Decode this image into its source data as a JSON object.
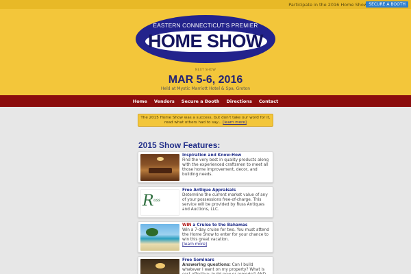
{
  "topbar": {
    "promo": "Participate in the 2016 Home Show:",
    "cta": "SECURE A BOOTH"
  },
  "header": {
    "logo_tagline": "EASTERN CONNECTICUT'S PREMIER",
    "logo_name": "HOME SHOW",
    "next_label": "NEXT SHOW",
    "dates": "MAR 5-6, 2016",
    "venue_prefix": "Held at Mystic Marriott",
    "venue_suffix": "Hotel & Spa, Groton"
  },
  "nav": {
    "items": [
      "Home",
      "Vendors",
      "Secure a Booth",
      "Directions",
      "Contact"
    ]
  },
  "notice": {
    "line1": "The 2015 Home Show was a success, but don't take our word for it,",
    "line2": "read what others had to say...",
    "link": "[learn more]"
  },
  "features": {
    "title": "2015 Show Features:",
    "cards": [
      {
        "title": "Inspiration and Know-How",
        "text": "Find the very best in quality products along with the experienced craftsmen to meet all those home improvement, decor, and building needs."
      },
      {
        "title": "Free Antique Appraisals",
        "text": "Determine the current market value of any of your possessions free-of-charge. This service will be provided by Russ Antiques and Auctions, LLC.",
        "logo_letter": "R",
        "logo_rest": "uss"
      },
      {
        "title_win": "WIN",
        "title": " a Cruise to the Bahamas",
        "text": "Win a 7-day cruise for two. You must attend the Home Show to enter for your chance to win this great vacation.",
        "link": "[learn more]"
      },
      {
        "title": "Free Seminars",
        "subtitle": "Answering questions:",
        "text": " Can I build whatever I want on my property? What is cost effective: build new or remodel? AND OTHERS"
      }
    ]
  },
  "colors": {
    "topbar": "#e8b927",
    "header": "#f3c63a",
    "nav": "#8b0d0d",
    "accent_blue": "#23238c",
    "cta_blue": "#2f7fcf"
  }
}
